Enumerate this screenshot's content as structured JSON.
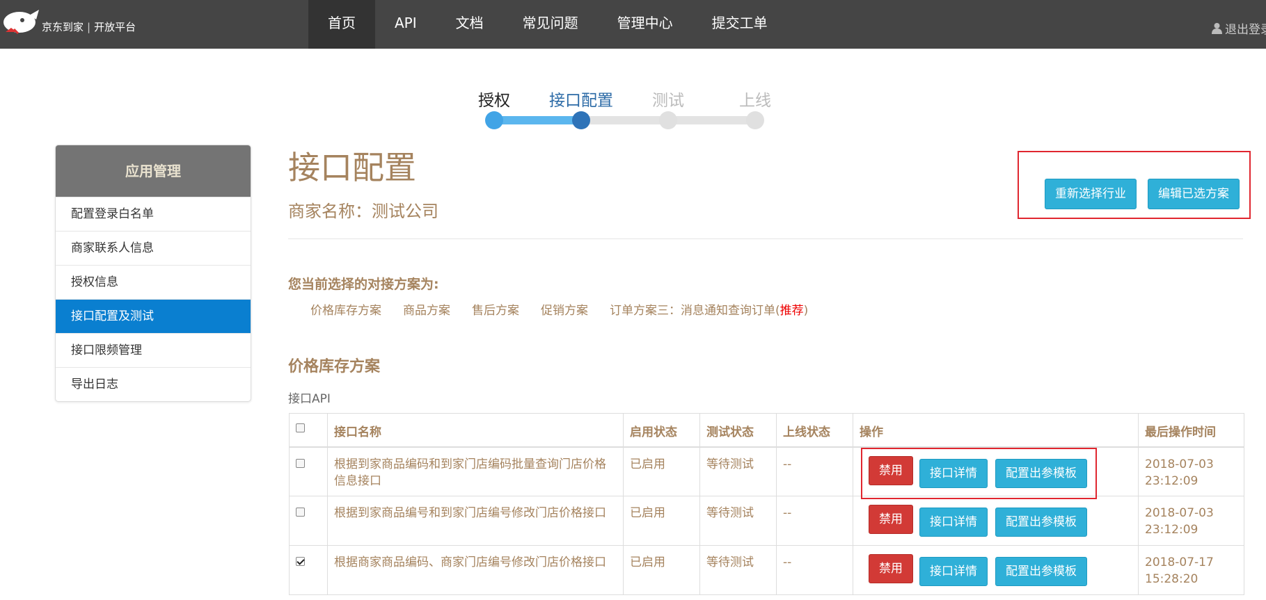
{
  "brand": {
    "name": "京东到家",
    "sep": "|",
    "platform": "开放平台"
  },
  "nav": [
    "首页",
    "API",
    "文档",
    "常见问题",
    "管理中心",
    "提交工单"
  ],
  "logout": "退出登录",
  "steps": [
    "授权",
    "接口配置",
    "测试",
    "上线"
  ],
  "steps_progress": {
    "completed": 1,
    "current": 2,
    "total": 4
  },
  "sidebar": {
    "header": "应用管理",
    "items": [
      "配置登录白名单",
      "商家联系人信息",
      "授权信息",
      "接口配置及测试",
      "接口限频管理",
      "导出日志"
    ],
    "active_index": 3
  },
  "main": {
    "title": "接口配置",
    "merchant": "商家名称：测试公司",
    "reselect_button": "重新选择行业",
    "edit_button": "编辑已选方案",
    "plan_heading": "您当前选择的对接方案为:",
    "plans": [
      "价格库存方案",
      "商品方案",
      "售后方案",
      "促销方案"
    ],
    "plan_last_prefix": "订单方案三：消息通知查询订单(",
    "plan_last_tag": "推荐",
    "plan_last_suffix": ")",
    "section_title": "价格库存方案",
    "api_label": "接口API"
  },
  "table": {
    "headers": [
      "接口名称",
      "启用状态",
      "测试状态",
      "上线状态",
      "操作",
      "最后操作时间"
    ],
    "rows": [
      {
        "checked": false,
        "name": "根据到家商品编码和到家门店编码批量查询门店价格信息接口",
        "enabled": "已启用",
        "test": "等待测试",
        "online": "--",
        "time": "2018-07-03 23:12:09"
      },
      {
        "checked": false,
        "name": "根据到家商品编号和到家门店编号修改门店价格接口",
        "enabled": "已启用",
        "test": "等待测试",
        "online": "--",
        "time": "2018-07-03 23:12:09"
      },
      {
        "checked": true,
        "name": "根据商家商品编码、商家门店编号修改门店价格接口",
        "enabled": "已启用",
        "test": "等待测试",
        "online": "--",
        "time": "2018-07-17 15:28:20"
      }
    ],
    "op_disable": "禁用",
    "op_detail": "接口详情",
    "op_template": "配置出参模板"
  },
  "colors": {
    "nav_bg": "#454545",
    "accent_text": "#a5835e",
    "sidebar_active": "#0a7fd0",
    "info_button": "#2fb0d8",
    "danger_button": "#d23a36",
    "highlight_box": "#e0262f",
    "enabled_text": "#2a9a2a"
  },
  "icons": {
    "logo": "jd-daojia-logo",
    "user": "user-icon"
  }
}
